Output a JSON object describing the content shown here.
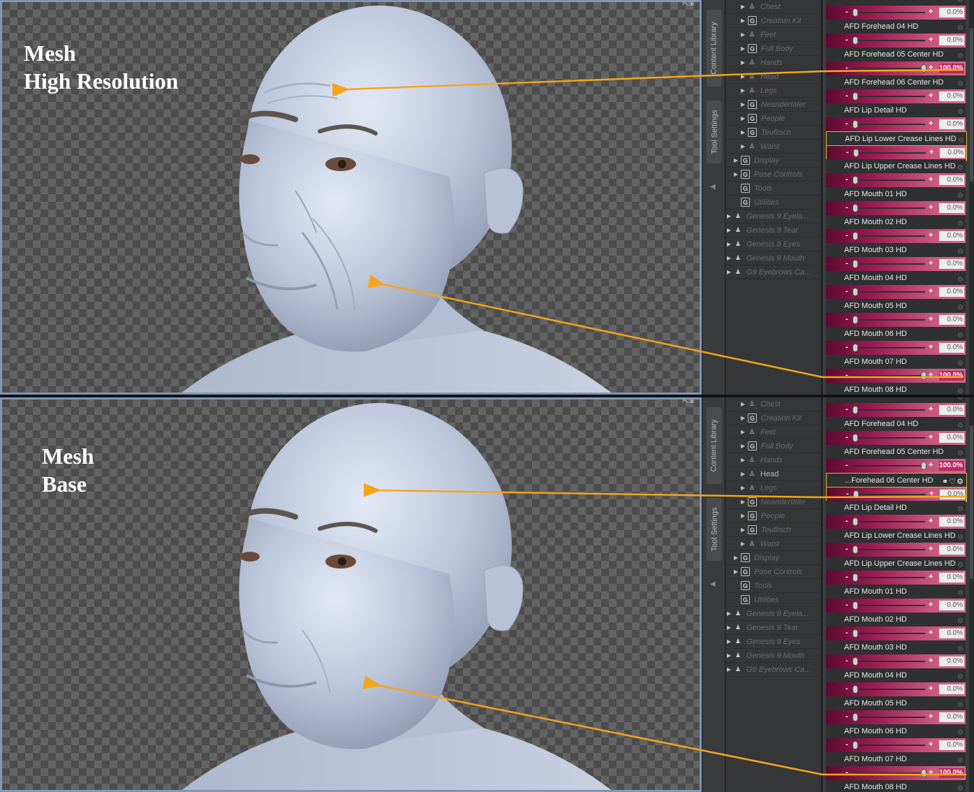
{
  "panels": [
    {
      "id": "top",
      "mesh_label": [
        "Mesh",
        "High Resolution"
      ],
      "tabs": {
        "content_library": "Content Library",
        "tool_settings": "Tool Settings"
      },
      "tree": [
        {
          "label": "Chest",
          "icon": "figure-icon",
          "active": false
        },
        {
          "label": "Creation Kit",
          "icon": "g-icon",
          "active": false
        },
        {
          "label": "Feet",
          "icon": "figure-icon",
          "active": false
        },
        {
          "label": "Full Body",
          "icon": "g-icon",
          "active": false
        },
        {
          "label": "Hands",
          "icon": "figure-icon",
          "active": false
        },
        {
          "label": "Head",
          "icon": "figure-icon",
          "active": false
        },
        {
          "label": "Legs",
          "icon": "figure-icon",
          "active": false
        },
        {
          "label": "Neandertaler",
          "icon": "g-icon",
          "active": false
        },
        {
          "label": "People",
          "icon": "g-icon",
          "active": false
        },
        {
          "label": "Teuflisch",
          "icon": "g-icon",
          "active": false
        },
        {
          "label": "Waist",
          "icon": "figure-icon",
          "active": false
        },
        {
          "label": "Display",
          "icon": "g-icon",
          "active": false
        },
        {
          "label": "Pose Controls",
          "icon": "g-icon",
          "active": false
        },
        {
          "label": "Tools",
          "icon": "g-icon",
          "active": false
        },
        {
          "label": "Utilities",
          "icon": "g-icon",
          "active": false
        },
        {
          "label": "Genesis 9 Eyela...",
          "icon": "node-icon",
          "active": false
        },
        {
          "label": "Genesis 9 Tear",
          "icon": "node-icon",
          "active": false
        },
        {
          "label": "Genesis 9 Eyes",
          "icon": "node-icon",
          "active": false
        },
        {
          "label": "Genesis 9 Mouth",
          "icon": "node-icon",
          "active": false
        },
        {
          "label": "G9 Eyebrows Ca...",
          "icon": "node-icon",
          "active": false
        }
      ],
      "properties": [
        {
          "label": "",
          "value": "0.0%"
        },
        {
          "label": "AFD Forehead 04 HD",
          "value": "0.0%"
        },
        {
          "label": "AFD Forehead 05 Center HD",
          "value": "100.0%"
        },
        {
          "label": "AFD Forehead 06 Center HD",
          "value": "0.0%"
        },
        {
          "label": "AFD Lip Detail HD",
          "value": "0.0%"
        },
        {
          "label": "AFD Lip Lower Crease Lines HD",
          "value": "0.0%"
        },
        {
          "label": "AFD Lip Upper Crease Lines HD",
          "value": "0.0%"
        },
        {
          "label": "AFD Mouth 01 HD",
          "value": "0.0%"
        },
        {
          "label": "AFD Mouth 02 HD",
          "value": "0.0%"
        },
        {
          "label": "AFD Mouth 03 HD",
          "value": "0.0%"
        },
        {
          "label": "AFD Mouth 04 HD",
          "value": "0.0%"
        },
        {
          "label": "AFD Mouth 05 HD",
          "value": "0.0%"
        },
        {
          "label": "AFD Mouth 06 HD",
          "value": "0.0%"
        },
        {
          "label": "AFD Mouth 07 HD",
          "value": "100.0%"
        },
        {
          "label": "AFD Mouth 08 HD",
          "value": ""
        }
      ]
    },
    {
      "id": "bottom",
      "mesh_label": [
        "Mesh",
        "Base"
      ],
      "tabs": {
        "content_library": "Content Library",
        "tool_settings": "Tool Settings"
      },
      "tree": [
        {
          "label": "Chest",
          "icon": "figure-icon",
          "active": false
        },
        {
          "label": "Creation Kit",
          "icon": "g-icon",
          "active": false
        },
        {
          "label": "Feet",
          "icon": "figure-icon",
          "active": false
        },
        {
          "label": "Full Body",
          "icon": "g-icon",
          "active": false
        },
        {
          "label": "Hands",
          "icon": "figure-icon",
          "active": false
        },
        {
          "label": "Head",
          "icon": "figure-icon",
          "active": true
        },
        {
          "label": "Legs",
          "icon": "figure-icon",
          "active": false
        },
        {
          "label": "Neandertaler",
          "icon": "g-icon",
          "active": false
        },
        {
          "label": "People",
          "icon": "g-icon",
          "active": false
        },
        {
          "label": "Teuflisch",
          "icon": "g-icon",
          "active": false
        },
        {
          "label": "Waist",
          "icon": "figure-icon",
          "active": false
        },
        {
          "label": "Display",
          "icon": "g-icon",
          "active": false
        },
        {
          "label": "Pose Controls",
          "icon": "g-icon",
          "active": false
        },
        {
          "label": "Tools",
          "icon": "g-icon",
          "active": false
        },
        {
          "label": "Utilities",
          "icon": "g-icon",
          "active": false
        },
        {
          "label": "Genesis 9 Eyela...",
          "icon": "node-icon",
          "active": false
        },
        {
          "label": "Genesis 9 Tear",
          "icon": "node-icon",
          "active": false
        },
        {
          "label": "Genesis 9 Eyes",
          "icon": "node-icon",
          "active": false
        },
        {
          "label": "Genesis 9 Mouth",
          "icon": "node-icon",
          "active": false
        },
        {
          "label": "G9 Eyebrows Ca...",
          "icon": "node-icon",
          "active": false
        }
      ],
      "properties": [
        {
          "label": "",
          "value": "0.0%"
        },
        {
          "label": "AFD Forehead 04 HD",
          "value": "0.0%"
        },
        {
          "label": "AFD Forehead 05 Center HD",
          "value": "100.0%"
        },
        {
          "label": "...Forehead 06 Center HD",
          "value": "0.0%"
        },
        {
          "label": "AFD Lip Detail HD",
          "value": "0.0%"
        },
        {
          "label": "AFD Lip Lower Crease Lines HD",
          "value": "0.0%"
        },
        {
          "label": "AFD Lip Upper Crease Lines HD",
          "value": "0.0%"
        },
        {
          "label": "AFD Mouth 01 HD",
          "value": "0.0%"
        },
        {
          "label": "AFD Mouth 02 HD",
          "value": "0.0%"
        },
        {
          "label": "AFD Mouth 03 HD",
          "value": "0.0%"
        },
        {
          "label": "AFD Mouth 04 HD",
          "value": "0.0%"
        },
        {
          "label": "AFD Mouth 05 HD",
          "value": "0.0%"
        },
        {
          "label": "AFD Mouth 06 HD",
          "value": "0.0%"
        },
        {
          "label": "AFD Mouth 07 HD",
          "value": "100.0%"
        },
        {
          "label": "AFD Mouth 08 HD",
          "value": ""
        }
      ]
    }
  ],
  "colors": {
    "arrow": "#f5a51c",
    "slider_dark": "#5c0a30",
    "slider_light": "#d06a8a",
    "viewport_border": "#8296b6",
    "highlight": "#d7b52a"
  }
}
